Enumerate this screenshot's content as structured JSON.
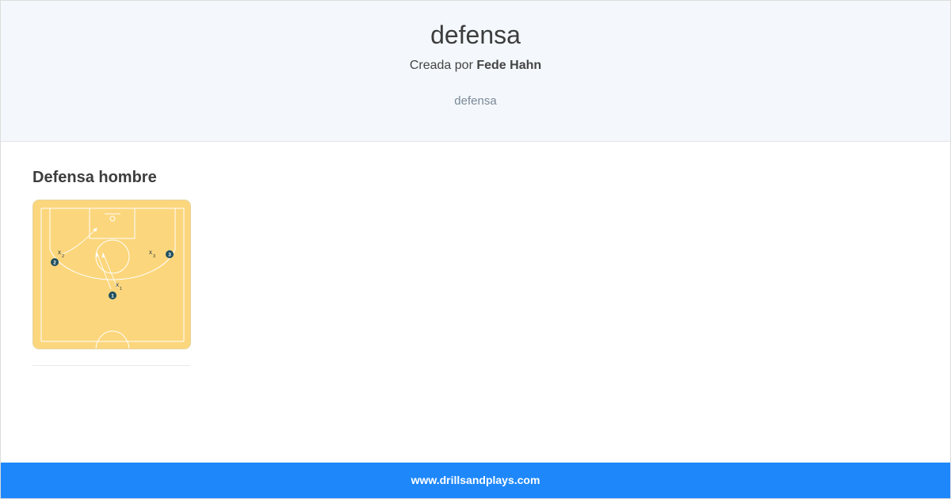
{
  "header": {
    "title": "defensa",
    "byline_prefix": "Creada por",
    "author": "Fede Hahn",
    "tag": "defensa"
  },
  "section": {
    "title": "Defensa hombre"
  },
  "diagram": {
    "court_color": "#fbd67c",
    "line_color": "#ffffff",
    "player_color": "#1f4e5f",
    "players": [
      "1",
      "2",
      "3"
    ],
    "defenders": [
      {
        "base": "x",
        "sub": "1"
      },
      {
        "base": "x",
        "sub": "2"
      },
      {
        "base": "x",
        "sub": "3"
      }
    ]
  },
  "footer": {
    "site": "www.drillsandplays.com"
  }
}
